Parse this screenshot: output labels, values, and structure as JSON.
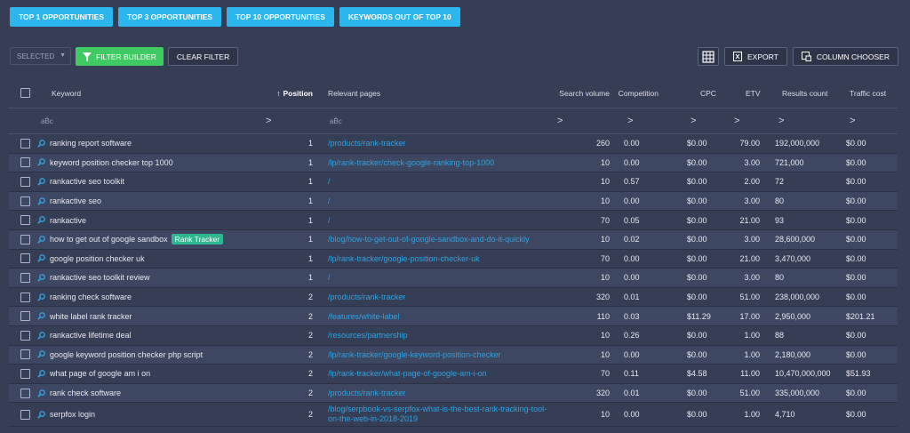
{
  "top_tabs": [
    "TOP 1 OPPORTUNITIES",
    "TOP 3 OPPORTUNITIES",
    "TOP 10 OPPORTUNITIES",
    "KEYWORDS OUT OF TOP 10"
  ],
  "toolbar": {
    "selected_label": "SELECTED",
    "filter_builder_label": "FILTER BUILDER",
    "clear_filter_label": "CLEAR FILTER",
    "export_label": "EXPORT",
    "column_chooser_label": "COLUMN CHOOSER"
  },
  "columns": {
    "keyword": "Keyword",
    "position": "Position",
    "relevant_pages": "Relevant pages",
    "search_volume": "Search volume",
    "competition": "Competition",
    "cpc": "CPC",
    "etv": "ETV",
    "results_count": "Results count",
    "traffic_cost": "Traffic cost"
  },
  "filter_row": {
    "abc": "aB̈c",
    "arrow": ">"
  },
  "rows": [
    {
      "keyword": "ranking report software",
      "badge": "",
      "position": "1",
      "page": "/products/rank-tracker",
      "volume": "260",
      "competition": "0.00",
      "cpc": "$0.00",
      "etv": "79.00",
      "results": "192,000,000",
      "cost": "$0.00"
    },
    {
      "keyword": "keyword position checker top 1000",
      "badge": "",
      "position": "1",
      "page": "/lp/rank-tracker/check-google-ranking-top-1000",
      "volume": "10",
      "competition": "0.00",
      "cpc": "$0.00",
      "etv": "3.00",
      "results": "721,000",
      "cost": "$0.00"
    },
    {
      "keyword": "rankactive seo toolkit",
      "badge": "",
      "position": "1",
      "page": "/",
      "volume": "10",
      "competition": "0.57",
      "cpc": "$0.00",
      "etv": "2.00",
      "results": "72",
      "cost": "$0.00"
    },
    {
      "keyword": "rankactive seo",
      "badge": "",
      "position": "1",
      "page": "/",
      "volume": "10",
      "competition": "0.00",
      "cpc": "$0.00",
      "etv": "3.00",
      "results": "80",
      "cost": "$0.00"
    },
    {
      "keyword": "rankactive",
      "badge": "",
      "position": "1",
      "page": "/",
      "volume": "70",
      "competition": "0.05",
      "cpc": "$0.00",
      "etv": "21.00",
      "results": "93",
      "cost": "$0.00"
    },
    {
      "keyword": "how to get out of google sandbox",
      "badge": "Rank Tracker",
      "position": "1",
      "page": "/blog/how-to-get-out-of-google-sandbox-and-do-it-quickly",
      "volume": "10",
      "competition": "0.02",
      "cpc": "$0.00",
      "etv": "3.00",
      "results": "28,600,000",
      "cost": "$0.00"
    },
    {
      "keyword": "google position checker uk",
      "badge": "",
      "position": "1",
      "page": "/lp/rank-tracker/google-position-checker-uk",
      "volume": "70",
      "competition": "0.00",
      "cpc": "$0.00",
      "etv": "21.00",
      "results": "3,470,000",
      "cost": "$0.00"
    },
    {
      "keyword": "rankactive seo toolkit review",
      "badge": "",
      "position": "1",
      "page": "/",
      "volume": "10",
      "competition": "0.00",
      "cpc": "$0.00",
      "etv": "3.00",
      "results": "80",
      "cost": "$0.00"
    },
    {
      "keyword": "ranking check software",
      "badge": "",
      "position": "2",
      "page": "/products/rank-tracker",
      "volume": "320",
      "competition": "0.01",
      "cpc": "$0.00",
      "etv": "51.00",
      "results": "238,000,000",
      "cost": "$0.00"
    },
    {
      "keyword": "white label rank tracker",
      "badge": "",
      "position": "2",
      "page": "/features/white-label",
      "volume": "110",
      "competition": "0.03",
      "cpc": "$11.29",
      "etv": "17.00",
      "results": "2,950,000",
      "cost": "$201.21"
    },
    {
      "keyword": "rankactive lifetime deal",
      "badge": "",
      "position": "2",
      "page": "/resources/partnership",
      "volume": "10",
      "competition": "0.26",
      "cpc": "$0.00",
      "etv": "1.00",
      "results": "88",
      "cost": "$0.00"
    },
    {
      "keyword": "google keyword position checker php script",
      "badge": "",
      "position": "2",
      "page": "/lp/rank-tracker/google-keyword-position-checker",
      "volume": "10",
      "competition": "0.00",
      "cpc": "$0.00",
      "etv": "1.00",
      "results": "2,180,000",
      "cost": "$0.00"
    },
    {
      "keyword": "what page of google am i on",
      "badge": "",
      "position": "2",
      "page": "/lp/rank-tracker/what-page-of-google-am-i-on",
      "volume": "70",
      "competition": "0.11",
      "cpc": "$4.58",
      "etv": "11.00",
      "results": "10,470,000,000",
      "cost": "$51.93"
    },
    {
      "keyword": "rank check software",
      "badge": "",
      "position": "2",
      "page": "/products/rank-tracker",
      "volume": "320",
      "competition": "0.01",
      "cpc": "$0.00",
      "etv": "51.00",
      "results": "335,000,000",
      "cost": "$0.00"
    },
    {
      "keyword": "serpfox login",
      "badge": "",
      "position": "2",
      "page": "/blog/serpbook-vs-serpfox-what-is-the-best-rank-tracking-tool-on-the-web-in-2018-2019",
      "volume": "10",
      "competition": "0.00",
      "cpc": "$0.00",
      "etv": "1.00",
      "results": "4,710",
      "cost": "$0.00"
    }
  ]
}
